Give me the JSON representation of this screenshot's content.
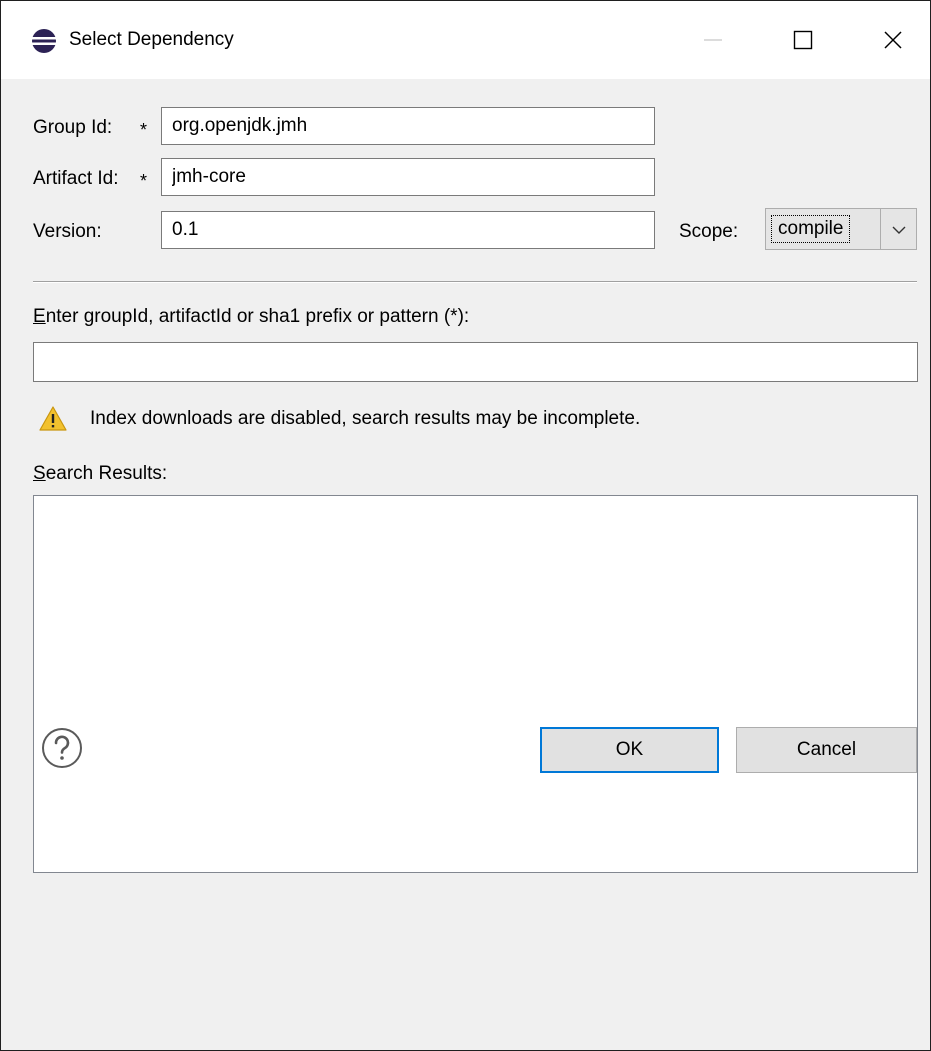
{
  "window": {
    "title": "Select Dependency",
    "icon": "eclipse-icon",
    "controls": [
      "minimize-icon",
      "maximize-icon",
      "close-icon"
    ]
  },
  "form": {
    "group_id": {
      "label": "Group Id:",
      "required_marker": "*",
      "value": "org.openjdk.jmh"
    },
    "artifact_id": {
      "label": "Artifact Id:",
      "required_marker": "*",
      "value": "jmh-core"
    },
    "version": {
      "label": "Version:",
      "value": "0.1"
    },
    "scope": {
      "label": "Scope:",
      "value": "compile"
    }
  },
  "search": {
    "label_mnemonic": "E",
    "label_rest": "nter groupId, artifactId or sha1 prefix or pattern (*):",
    "value": ""
  },
  "warning": {
    "icon": "warning-icon",
    "text": "Index downloads are disabled, search results may be incomplete."
  },
  "results": {
    "label_mnemonic": "S",
    "label_rest": "earch Results:",
    "items": []
  },
  "footer": {
    "help_icon": "help-icon",
    "ok_label": "OK",
    "cancel_label": "Cancel"
  },
  "colors": {
    "dialog_bg": "#f0f0f0",
    "focus_border": "#0078d7",
    "warning_yellow": "#f2c12e"
  }
}
